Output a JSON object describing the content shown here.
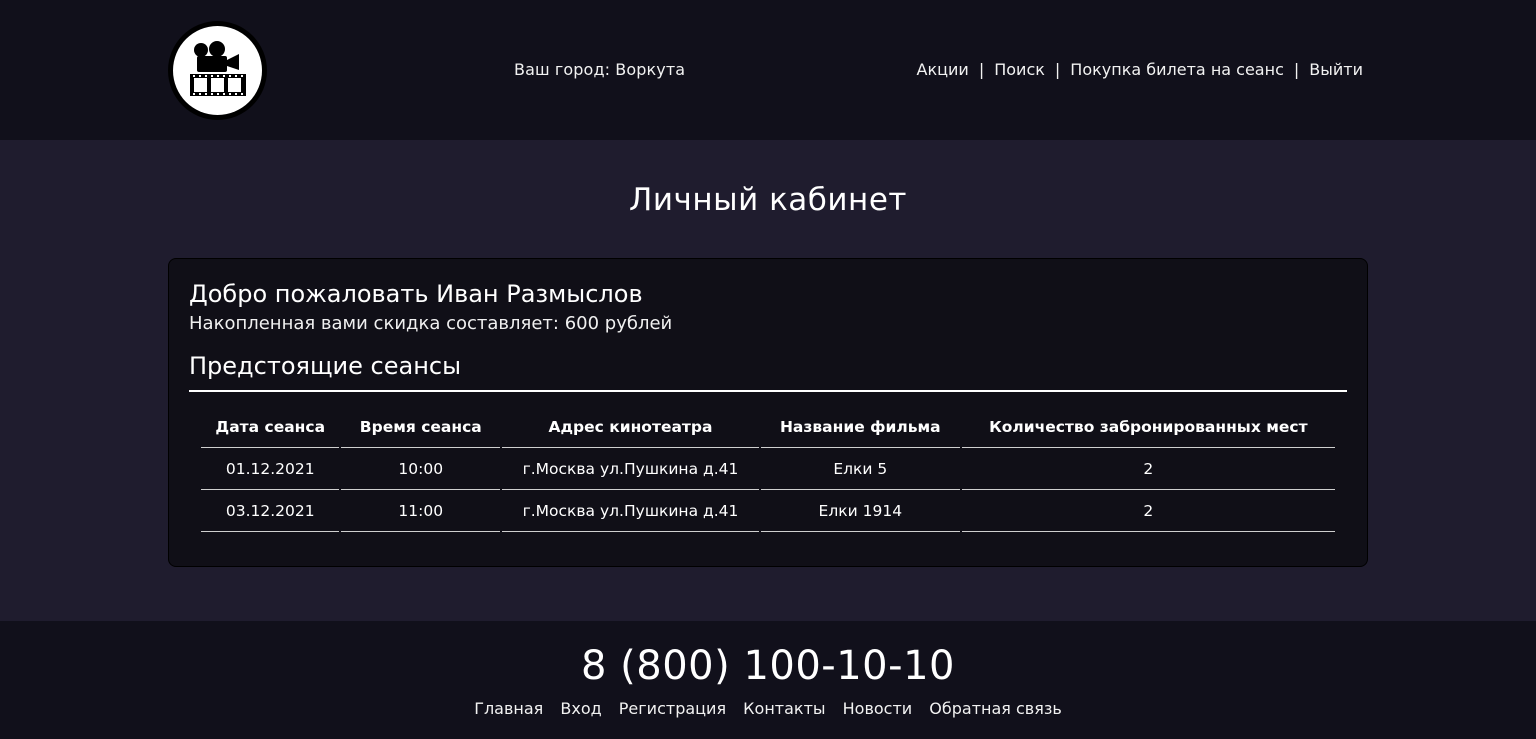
{
  "header": {
    "city_label": "Ваш город: Воркута",
    "nav": [
      "Акции",
      "Поиск",
      "Покупка билета на сеанс",
      "Выйти"
    ],
    "separator": "|"
  },
  "main": {
    "page_title": "Личный кабинет",
    "welcome": "Добро пожаловать Иван Размыслов",
    "discount": "Накопленная вами скидка составляет: 600 рублей",
    "section_title": "Предстоящие сеансы",
    "table": {
      "headers": [
        "Дата сеанса",
        "Время сеанса",
        "Адрес кинотеатра",
        "Название фильма",
        "Количество забронированных мест"
      ],
      "rows": [
        [
          "01.12.2021",
          "10:00",
          "г.Москва ул.Пушкина д.41",
          "Елки 5",
          "2"
        ],
        [
          "03.12.2021",
          "11:00",
          "г.Москва ул.Пушкина д.41",
          "Елки 1914",
          "2"
        ]
      ]
    }
  },
  "footer": {
    "phone": "8 (800) 100-10-10",
    "links": [
      "Главная",
      "Вход",
      "Регистрация",
      "Контакты",
      "Новости",
      "Обратная связь"
    ]
  },
  "colors": {
    "header_bg": "#11101b",
    "page_bg": "#1f1c2e",
    "card_bg": "#100f17"
  },
  "icons": {
    "logo": "film-camera-icon"
  }
}
